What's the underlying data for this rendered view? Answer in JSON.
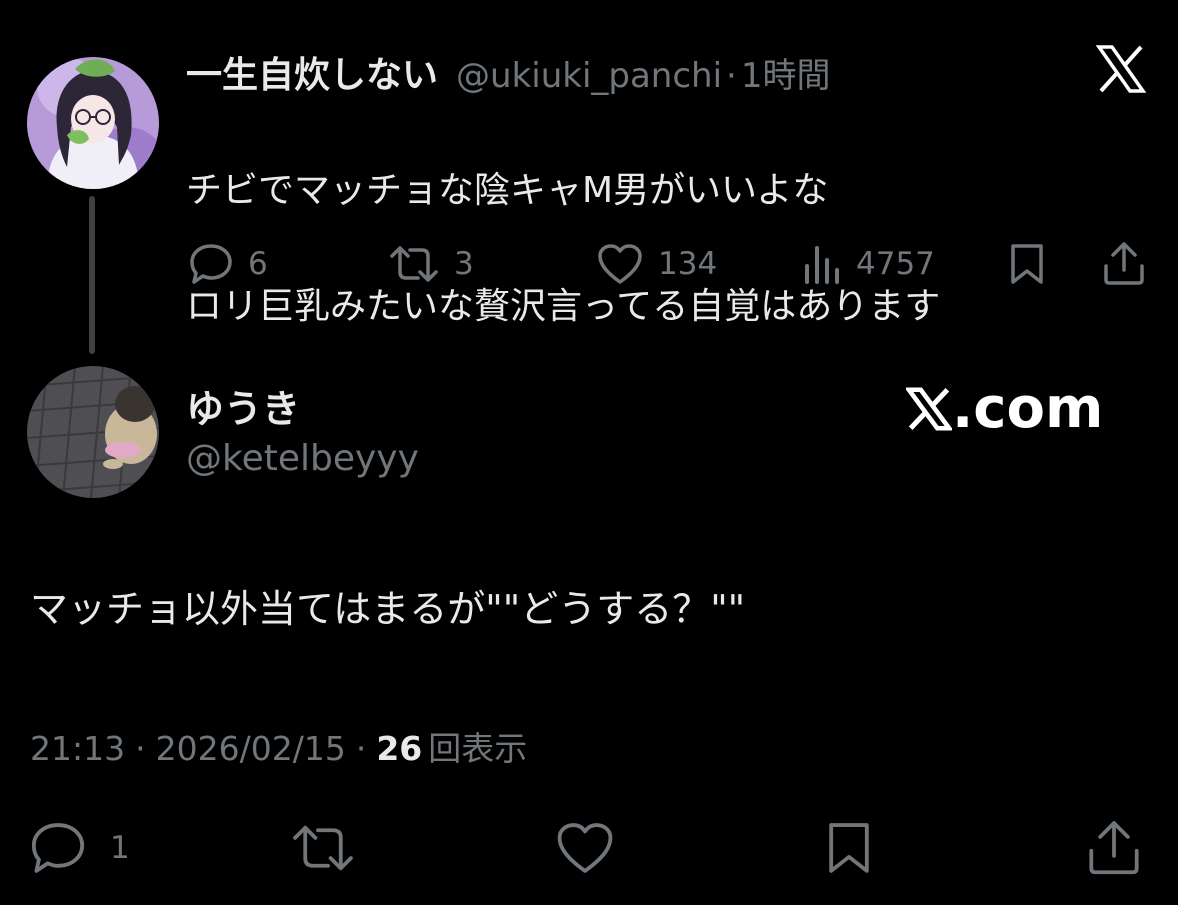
{
  "parent_tweet": {
    "display_name": "一生自炊しない",
    "handle": "@ukiuki_panchi",
    "time_ago": "1時間",
    "text_lines": [
      "チビでマッチョな陰キャM男がいいよな",
      "ロリ巨乳みたいな贅沢言ってる自覚はあります"
    ],
    "metrics": {
      "replies": "6",
      "retweets": "3",
      "likes": "134",
      "views": "4757"
    },
    "icons": {
      "brand": "x-logo-icon",
      "reply": "reply-icon",
      "retweet": "retweet-icon",
      "like": "heart-icon",
      "views": "views-icon",
      "bookmark": "bookmark-icon",
      "share": "share-icon"
    }
  },
  "reply_tweet": {
    "display_name": "ゆうき",
    "handle": "@ketelbeyyy",
    "watermark_text": ".com",
    "text": "マッチョ以外当てはまるが\"\"どうする？\"\"",
    "timestamp": "21:13",
    "date": "2026/02/15",
    "view_count": "26",
    "view_label": "回表示",
    "separator": "·",
    "actions": {
      "reply_count": "1"
    },
    "icons": {
      "reply": "reply-icon",
      "retweet": "retweet-icon",
      "like": "heart-icon",
      "bookmark": "bookmark-icon",
      "share": "share-icon"
    }
  },
  "colors": {
    "background": "#000000",
    "primary_text": "#e7e9ea",
    "secondary_text": "#71767b",
    "thread_line": "#3e4144"
  }
}
